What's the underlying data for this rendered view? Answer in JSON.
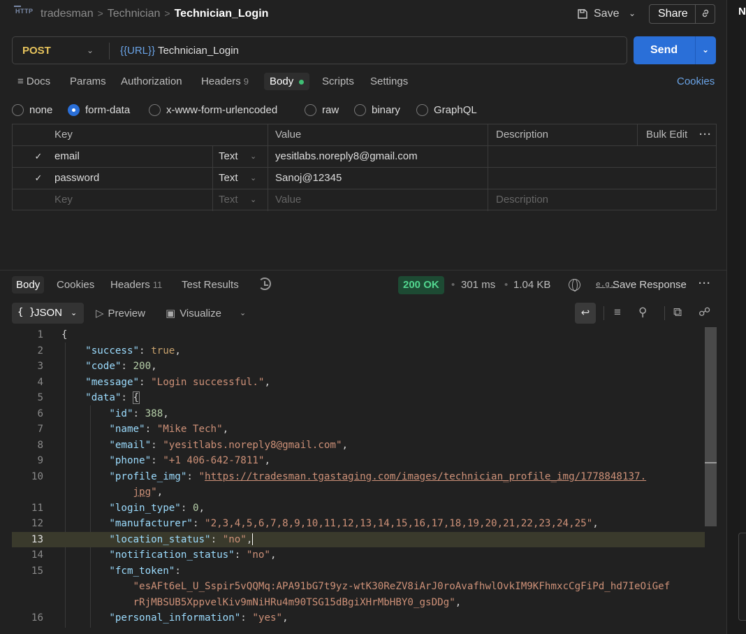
{
  "header": {
    "crumbs": [
      "tradesman",
      "Technician",
      "Technician_Login"
    ],
    "save_label": "Save",
    "share_label": "Share"
  },
  "request": {
    "method": "POST",
    "url_var": "{{URL}}",
    "url_path": " Technician_Login",
    "send_label": "Send",
    "tabs": [
      {
        "label": "Docs"
      },
      {
        "label": "Params"
      },
      {
        "label": "Authorization"
      },
      {
        "label": "Headers",
        "count": "9"
      },
      {
        "label": "Body"
      },
      {
        "label": "Scripts"
      },
      {
        "label": "Settings"
      }
    ],
    "cookies_label": "Cookies",
    "body_types": [
      "none",
      "form-data",
      "x-www-form-urlencoded",
      "raw",
      "binary",
      "GraphQL"
    ],
    "selected_body_type": "form-data",
    "table": {
      "headers": {
        "key": "Key",
        "value": "Value",
        "description": "Description",
        "bulk_edit": "Bulk Edit"
      },
      "rows": [
        {
          "key": "email",
          "type": "Text",
          "value": "yesitlabs.noreply8@gmail.com",
          "checked": true
        },
        {
          "key": "password",
          "type": "Text",
          "value": "Sanoj@12345",
          "checked": true
        }
      ],
      "placeholder": {
        "key": "Key",
        "type": "Text",
        "value": "Value",
        "description": "Description"
      }
    }
  },
  "response": {
    "tabs": [
      {
        "label": "Body"
      },
      {
        "label": "Cookies"
      },
      {
        "label": "Headers",
        "count": "11"
      },
      {
        "label": "Test Results"
      }
    ],
    "status": "200 OK",
    "time": "301 ms",
    "size": "1.04 KB",
    "save_response": "Save Response",
    "eg_label": "e.g.",
    "format": "JSON",
    "format_brace": "{ }",
    "preview_label": "Preview",
    "visualize_label": "Visualize",
    "line_numbers": [
      "1",
      "2",
      "3",
      "4",
      "5",
      "6",
      "7",
      "8",
      "9",
      "10",
      "11",
      "12",
      "13",
      "14",
      "15",
      "16"
    ],
    "code": {
      "open_brace": "{",
      "success_key": "\"success\"",
      "success_val": "true",
      "code_key": "\"code\"",
      "code_val": "200",
      "message_key": "\"message\"",
      "message_val": "\"Login successful.\"",
      "data_key": "\"data\"",
      "data_brace": "{",
      "id_key": "\"id\"",
      "id_val": "388",
      "name_key": "\"name\"",
      "name_val": "\"Mike Tech\"",
      "email_key": "\"email\"",
      "email_val": "\"yesitlabs.noreply8@gmail.com\"",
      "phone_key": "\"phone\"",
      "phone_val": "\"+1 406-642-7811\"",
      "profile_key": "\"profile_img\"",
      "profile_url1": "https://tradesman.tgastaging.com/images/technician_profile_img/1778848137.",
      "profile_url2": "jpg",
      "login_type_key": "\"login_type\"",
      "login_type_val": "0",
      "manufacturer_key": "\"manufacturer\"",
      "manufacturer_val": "\"2,3,4,5,6,7,8,9,10,11,12,13,14,15,16,17,18,19,20,21,22,23,24,25\"",
      "location_key": "\"location_status\"",
      "location_val": "\"no\"",
      "notification_key": "\"notification_status\"",
      "notification_val": "\"no\"",
      "fcm_key": "\"fcm_token\"",
      "fcm_val1": "\"esAFt6eL_U_Sspir5vQQMq:APA91bG7t9yz-wtK30ReZV8iArJ0roAvafhwlOvkIM9KFhmxcCgFiPd_hd7IeOiGef",
      "fcm_val2": "rRjMBSUB5XppvelKiv9mNiHRu4m90TSG15dBgiXHrMbHBY0_gsDDg\"",
      "personal_key": "\"personal_information\"",
      "personal_val": "\"yes\""
    }
  },
  "right_panel": {
    "letter": "N"
  }
}
